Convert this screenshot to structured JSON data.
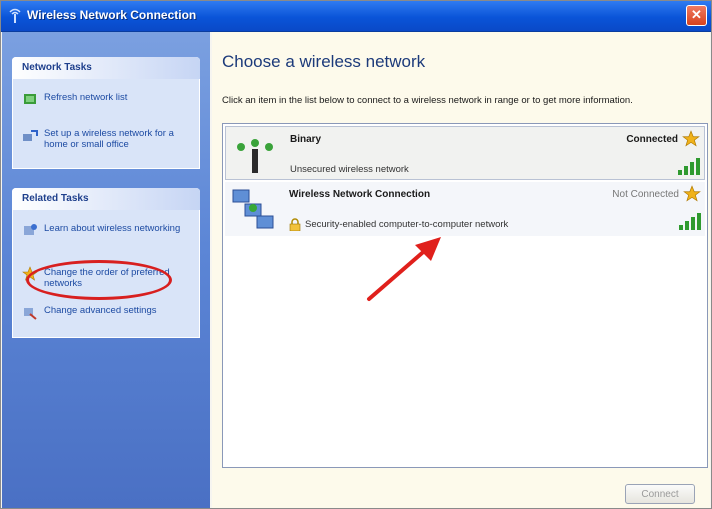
{
  "window": {
    "title": "Wireless Network Connection",
    "close_glyph": "✕"
  },
  "sidebar": {
    "network_tasks": {
      "heading": "Network Tasks",
      "items": [
        {
          "label": "Refresh network list",
          "icon": "refresh-icon"
        },
        {
          "label": "Set up a wireless network for a home or small office",
          "icon": "setup-network-icon"
        }
      ]
    },
    "related_tasks": {
      "heading": "Related Tasks",
      "items": [
        {
          "label": "Learn about wireless networking",
          "icon": "info-icon"
        },
        {
          "label": "Change the order of preferred networks",
          "icon": "star-icon"
        },
        {
          "label": "Change advanced settings",
          "icon": "settings-icon"
        }
      ]
    }
  },
  "main": {
    "heading": "Choose a wireless network",
    "description": "Click an item in the list below to connect to a wireless network in range or to get more information.",
    "networks": [
      {
        "name": "Binary",
        "status": "Connected",
        "subtitle": "Unsecured wireless network",
        "signal": 4
      },
      {
        "name": "Wireless Network Connection",
        "status": "Not Connected",
        "subtitle": "Security-enabled computer-to-computer network",
        "signal": 4
      }
    ],
    "connect_label": "Connect"
  },
  "colors": {
    "titlebar": "#0a54d8",
    "sidebar": "#5c86d6",
    "highlight": "#d81f1f"
  }
}
